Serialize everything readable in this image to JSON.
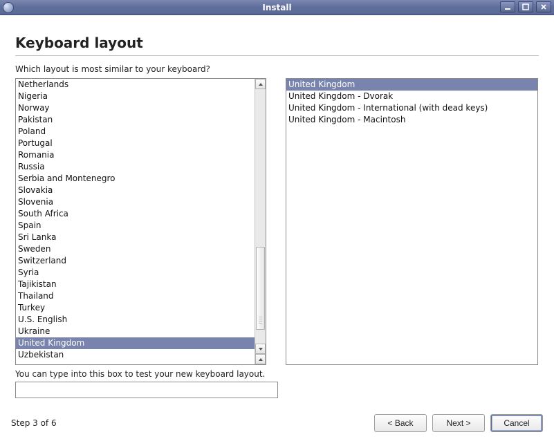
{
  "window": {
    "title": "Install"
  },
  "page": {
    "heading": "Keyboard layout",
    "prompt": "Which layout is most similar to your keyboard?",
    "hint": "You can type into this box to test your new keyboard layout.",
    "test_value": ""
  },
  "countries": {
    "selected_index": 22,
    "items": [
      "Netherlands",
      "Nigeria",
      "Norway",
      "Pakistan",
      "Poland",
      "Portugal",
      "Romania",
      "Russia",
      "Serbia and Montenegro",
      "Slovakia",
      "Slovenia",
      "South Africa",
      "Spain",
      "Sri Lanka",
      "Sweden",
      "Switzerland",
      "Syria",
      "Tajikistan",
      "Thailand",
      "Turkey",
      "U.S. English",
      "Ukraine",
      "United Kingdom",
      "Uzbekistan"
    ]
  },
  "variants": {
    "selected_index": 0,
    "items": [
      "United Kingdom",
      "United Kingdom - Dvorak",
      "United Kingdom - International (with dead keys)",
      "United Kingdom - Macintosh"
    ]
  },
  "footer": {
    "step": "Step 3 of 6",
    "back": "< Back",
    "next": "Next >",
    "cancel": "Cancel"
  }
}
